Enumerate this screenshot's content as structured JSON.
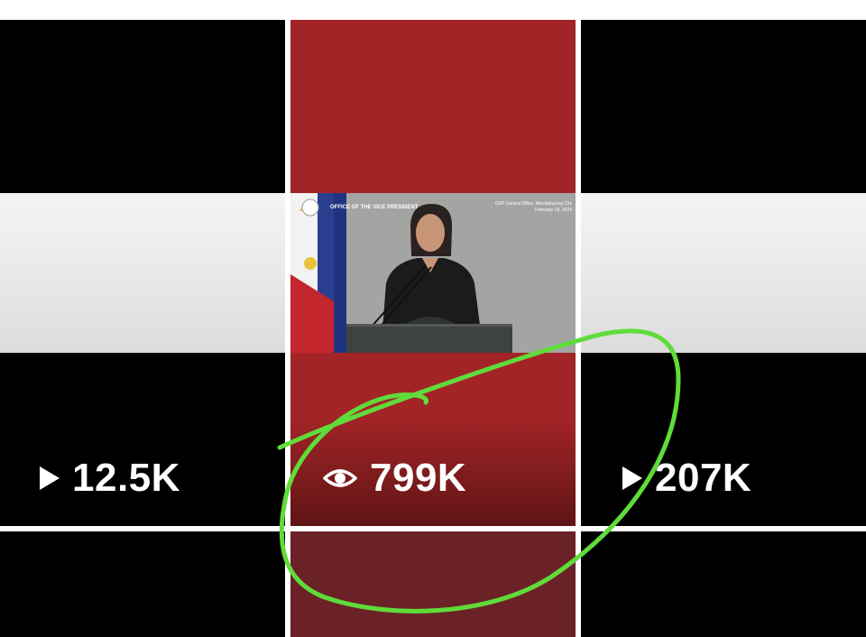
{
  "grid": {
    "tiles": [
      {
        "stat_icon": "play-icon",
        "stat_text": "12.5K"
      },
      {
        "stat_icon": "eye-icon",
        "stat_text": "799K",
        "thumbnail": {
          "org_text": "OFFICE OF THE VICE PRESIDENT",
          "caption_line1": "OVP Central Office, Mandaluyong City",
          "caption_line2": "February 18, 2024"
        }
      },
      {
        "stat_icon": "play-icon",
        "stat_text": "207K"
      }
    ]
  },
  "colors": {
    "highlight_tile": "#a32426",
    "highlight_tile_lower": "#6b2227",
    "dark_tile": "#000000",
    "annotation_stroke": "#5fdc3a"
  },
  "annotation": {
    "shape": "hand-drawn circle",
    "target": "view-count 799K"
  }
}
